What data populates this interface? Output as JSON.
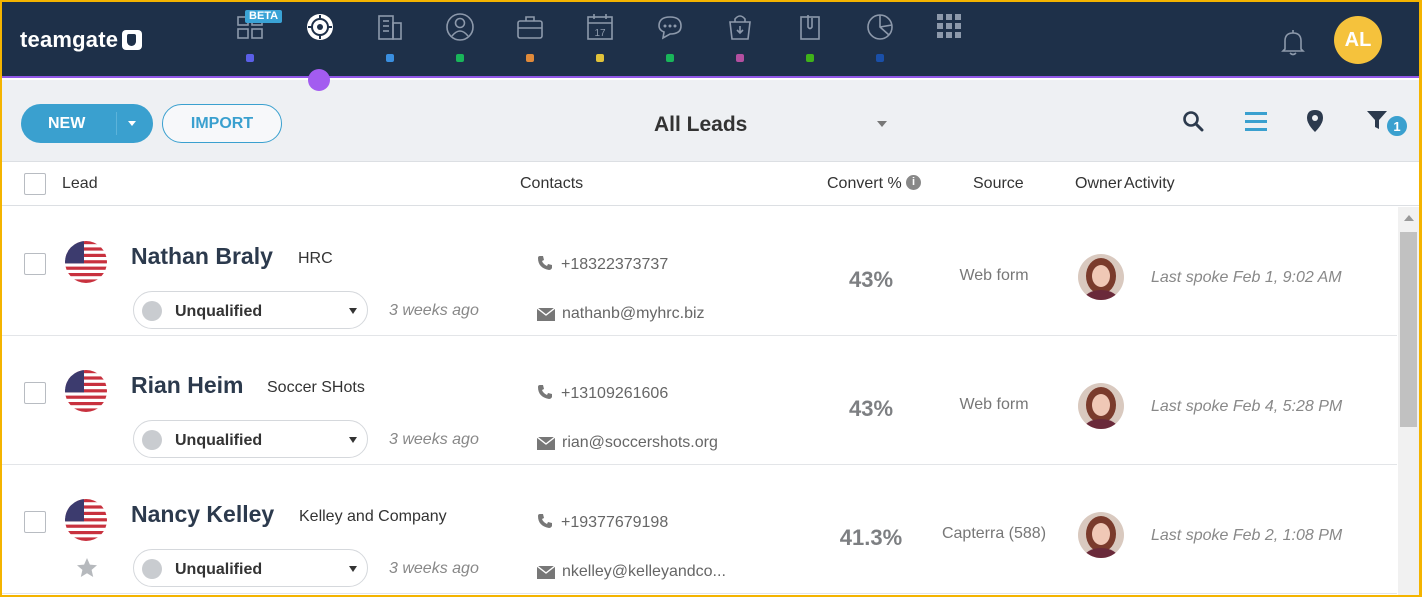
{
  "brand": {
    "logo_text": "teamgate"
  },
  "nav": {
    "beta_label": "BETA",
    "items": [
      {
        "icon": "dashboard-icon",
        "dot_color": "#5b5fe8",
        "active": false
      },
      {
        "icon": "leads-target-icon",
        "dot_color": "#a35cf0",
        "active": true
      },
      {
        "icon": "companies-building-icon",
        "dot_color": "#3a8fe0",
        "active": false
      },
      {
        "icon": "people-icon",
        "dot_color": "#19b55a",
        "active": false
      },
      {
        "icon": "deals-briefcase-icon",
        "dot_color": "#e08a3a",
        "active": false
      },
      {
        "icon": "calendar-icon",
        "calendar_day": "17",
        "dot_color": "#e0c23a",
        "active": false
      },
      {
        "icon": "chat-icon",
        "dot_color": "#19b55a",
        "active": false
      },
      {
        "icon": "shopping-bag-icon",
        "dot_color": "#b34fa0",
        "active": false
      },
      {
        "icon": "documents-clip-icon",
        "dot_color": "#3fb21a",
        "active": false
      },
      {
        "icon": "reports-pie-icon",
        "dot_color": "#1a4fa8",
        "active": false
      },
      {
        "icon": "apps-grid-icon",
        "dot_color": "",
        "active": false
      }
    ],
    "user_initials": "AL",
    "user_avatar_color": "#f5c23c"
  },
  "toolbar": {
    "new_label": "NEW",
    "import_label": "IMPORT",
    "view_label": "All Leads",
    "filter_count": "1",
    "accent_color": "#3aa0cf"
  },
  "table": {
    "headers": {
      "lead": "Lead",
      "contacts": "Contacts",
      "convert": "Convert %",
      "source": "Source",
      "owner": "Owner",
      "activity": "Activity"
    },
    "rows": [
      {
        "name": "Nathan Braly",
        "company": "HRC",
        "status": "Unqualified",
        "ago": "3 weeks ago",
        "phone": "+18322373737",
        "email": "nathanb@myhrc.biz",
        "convert": "43%",
        "source": "Web form",
        "activity": "Last spoke Feb 1, 9:02 AM",
        "starred": false
      },
      {
        "name": "Rian Heim",
        "company": "Soccer SHots",
        "status": "Unqualified",
        "ago": "3 weeks ago",
        "phone": "+13109261606",
        "email": "rian@soccershots.org",
        "convert": "43%",
        "source": "Web form",
        "activity": "Last spoke Feb 4, 5:28 PM",
        "starred": false
      },
      {
        "name": "Nancy Kelley",
        "company": "Kelley and Company",
        "status": "Unqualified",
        "ago": "3 weeks ago",
        "phone": "+19377679198",
        "email": "nkelley@kelleyandco...",
        "convert": "41.3%",
        "source": "Capterra (588)",
        "activity": "Last spoke Feb 2, 1:08 PM",
        "starred": true
      }
    ]
  }
}
